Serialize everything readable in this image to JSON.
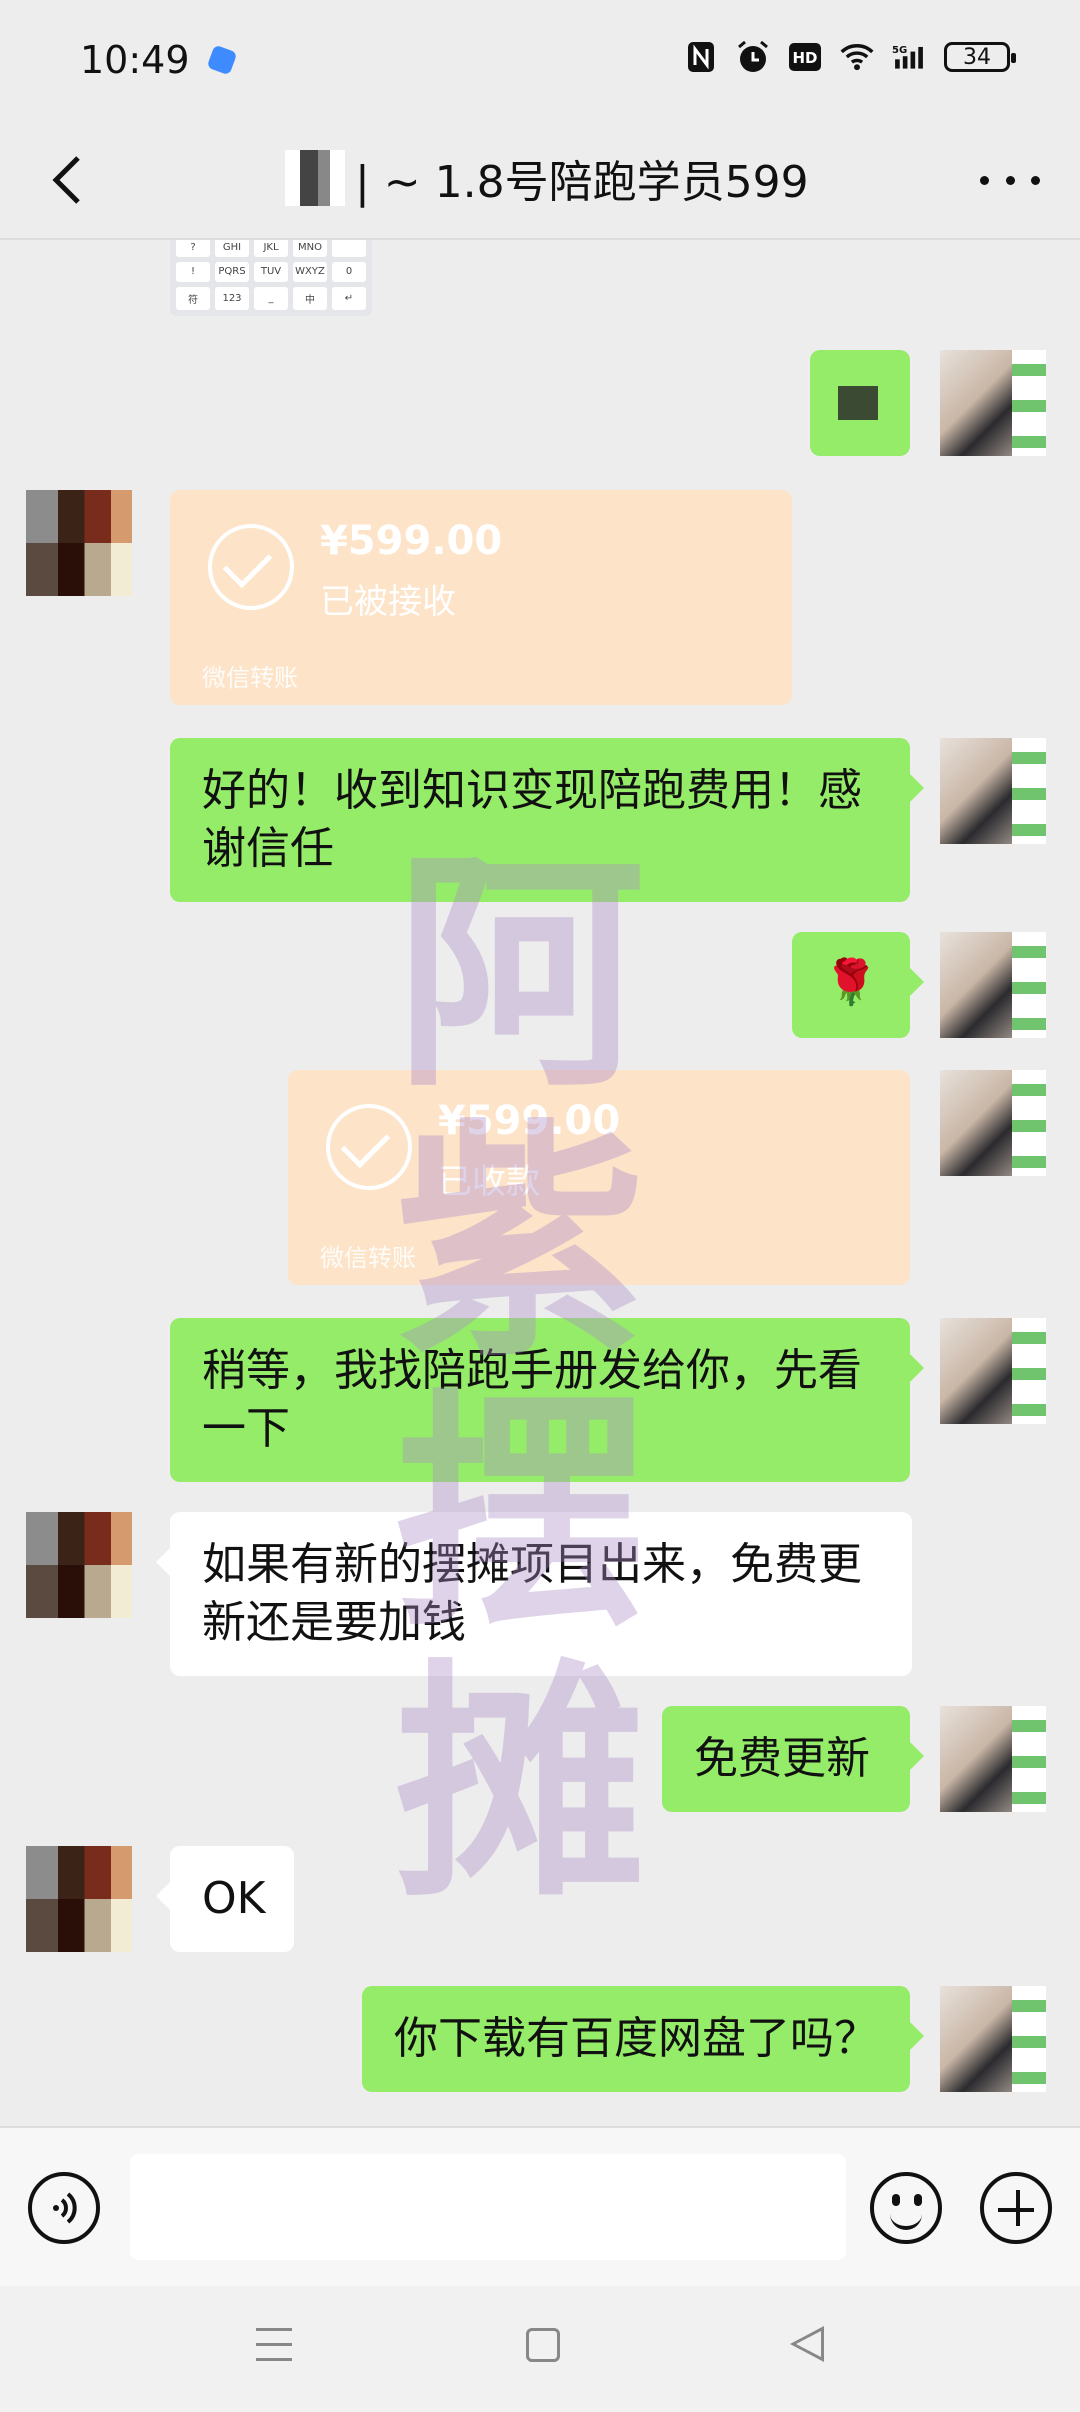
{
  "status_bar": {
    "time": "10:49",
    "battery": "34",
    "network": "5G",
    "hd": "HD"
  },
  "header": {
    "title": "| ~ 1.8号陪跑学员599"
  },
  "messages": {
    "m1_text": "好的！收到知识变现陪跑费用！感谢信任",
    "m2_emoji": "🌹",
    "m3_text": "稍等，我找陪跑手册发给你，先看一下",
    "m4_text": "如果有新的摆摊项目出来，免费更新还是要加钱",
    "m5_text": "免费更新",
    "m6_text": "OK",
    "m7_text": "你下载有百度网盘了吗？"
  },
  "transfers": {
    "t1": {
      "amount": "¥599.00",
      "status": "已被接收",
      "footer": "微信转账"
    },
    "t2": {
      "amount": "¥599.00",
      "status": "已收款",
      "footer": "微信转账"
    }
  },
  "keyboard_thumb": [
    "?",
    "GHI",
    "JKL",
    "MNO",
    "",
    "!",
    "PQRS",
    "TUV",
    "WXYZ",
    "0",
    "符",
    "123",
    "_",
    "中",
    "↵"
  ],
  "watermark": "阿紫摆摊",
  "colors": {
    "bubble_green": "#95ec69",
    "transfer_orange": "#fde3c8",
    "background": "#ededed"
  }
}
